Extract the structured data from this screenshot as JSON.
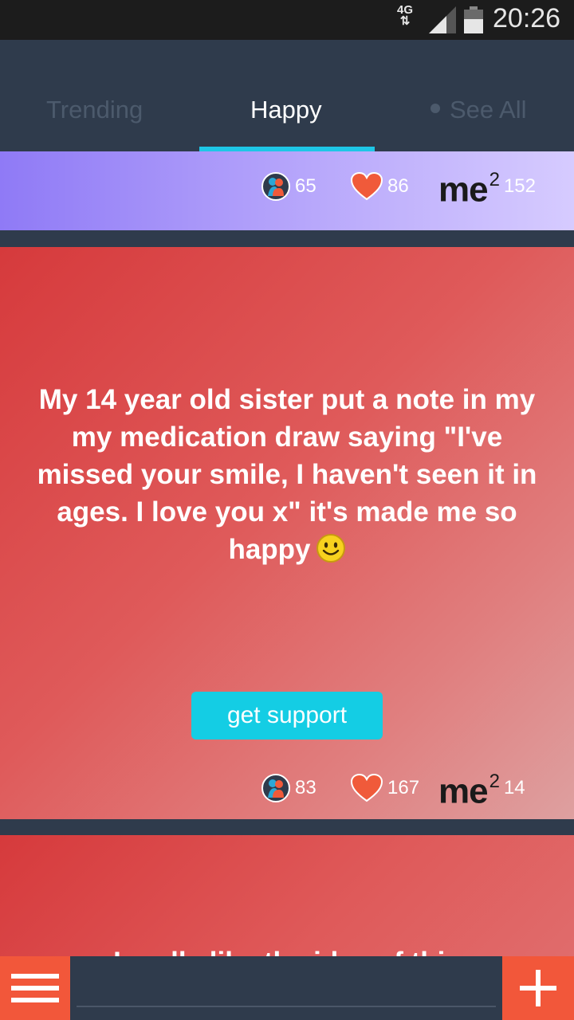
{
  "status_bar": {
    "network": "4G",
    "network_arrows": "⇅",
    "time": "20:26"
  },
  "tabs": [
    {
      "label": "Trending"
    },
    {
      "label": "Happy"
    },
    {
      "label": "See All"
    }
  ],
  "posts": [
    {
      "hugs": "65",
      "likes": "86",
      "me2_count": "152"
    },
    {
      "text": "My 14 year old sister put a note in my my medication draw saying \"I've missed your smile, I haven't seen it in ages. I love you x\" it's made me so happy",
      "support_label": "get support",
      "hugs": "83",
      "likes": "167",
      "me2_count": "14"
    },
    {
      "partial_text": "I really like the idea of this"
    }
  ],
  "me2_label": {
    "text": "me",
    "sup": "2"
  },
  "bottom_bar": {
    "input_placeholder": ""
  },
  "colors": {
    "accent": "#1ec6e6",
    "action": "#f2573a",
    "bar": "#2f3b4c"
  }
}
